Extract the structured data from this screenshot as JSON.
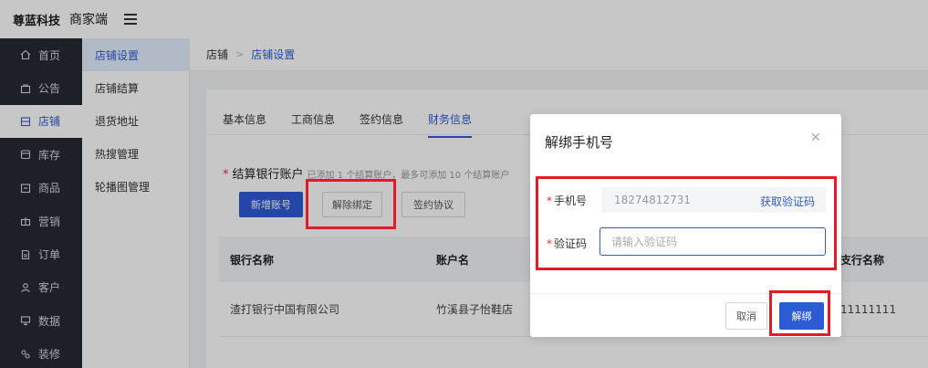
{
  "header": {
    "brand": "尊蓝科技",
    "app_name": "商家端"
  },
  "sidebar": {
    "items": [
      {
        "label": "首页",
        "icon": "home-icon"
      },
      {
        "label": "公告",
        "icon": "notice-icon"
      },
      {
        "label": "店铺",
        "icon": "store-icon",
        "active": true
      },
      {
        "label": "库存",
        "icon": "stock-icon"
      },
      {
        "label": "商品",
        "icon": "goods-icon"
      },
      {
        "label": "营销",
        "icon": "gift-icon"
      },
      {
        "label": "订单",
        "icon": "order-icon"
      },
      {
        "label": "客户",
        "icon": "customer-icon"
      },
      {
        "label": "数据",
        "icon": "data-icon"
      },
      {
        "label": "装修",
        "icon": "decor-icon"
      }
    ]
  },
  "subnav": {
    "items": [
      {
        "label": "店铺设置",
        "active": true
      },
      {
        "label": "店铺结算"
      },
      {
        "label": "退货地址"
      },
      {
        "label": "热搜管理"
      },
      {
        "label": "轮播图管理"
      }
    ]
  },
  "breadcrumb": {
    "root": "店铺",
    "current": "店铺设置"
  },
  "tabs": [
    "基本信息",
    "工商信息",
    "签约信息",
    "财务信息"
  ],
  "section": {
    "title": "结算银行账户",
    "hint": "已添加 1 个结算账户，最多可添加 10 个结算账户"
  },
  "buttons": {
    "add": "新增账号",
    "unbind": "解除绑定",
    "agreement": "签约协议"
  },
  "table": {
    "headers": [
      "银行名称",
      "账户名",
      "支行名称"
    ],
    "rows": [
      [
        "渣打银行中国有限公司",
        "竹溪县子怡鞋店",
        "11111111"
      ]
    ]
  },
  "modal": {
    "title": "解绑手机号",
    "phone_label": "手机号",
    "phone_value": "18274812731",
    "get_code": "获取验证码",
    "code_label": "验证码",
    "code_placeholder": "请输入验证码",
    "cancel": "取消",
    "confirm": "解绑"
  },
  "colors": {
    "accent": "#2d5bd6",
    "sidebar_bg": "#262a33",
    "highlight": "#e21b24"
  }
}
